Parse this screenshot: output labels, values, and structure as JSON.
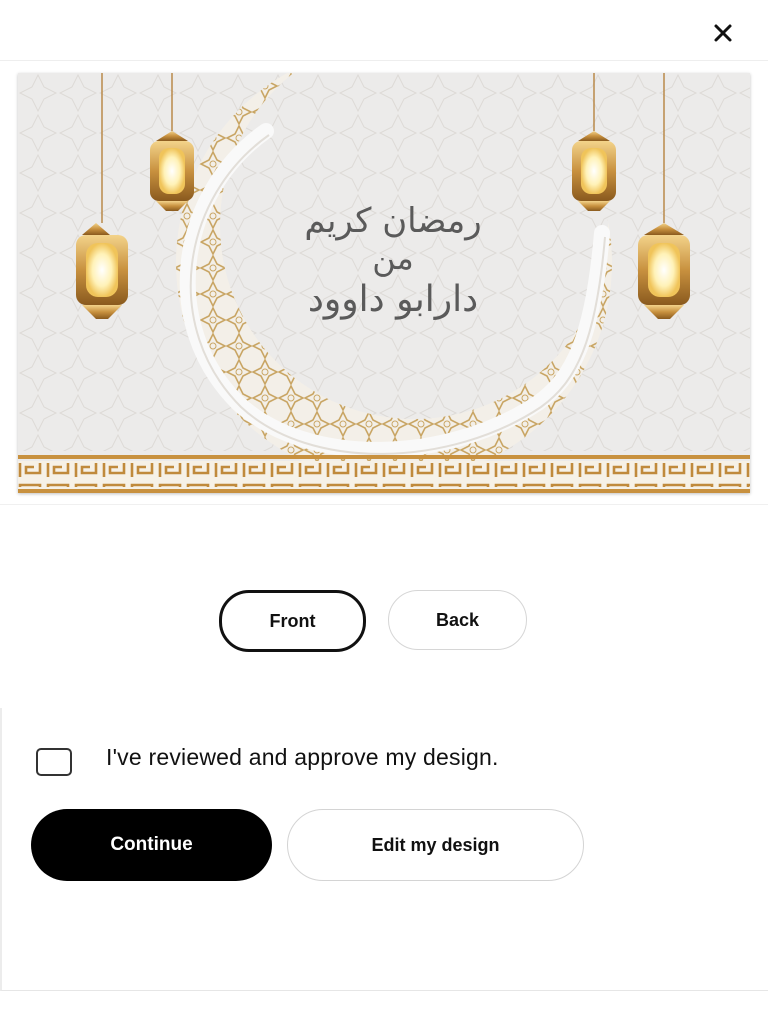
{
  "header": {
    "close_icon": "close-icon"
  },
  "preview": {
    "greeting_line1": "رمضان كريم",
    "greeting_line2": "من",
    "greeting_line3": "دارابو داوود",
    "colors": {
      "gold": "#c89a4a",
      "background": "#ecebea",
      "moon": "#f7f7f7"
    }
  },
  "sides": {
    "front_label": "Front",
    "back_label": "Back",
    "selected": "Front"
  },
  "approval": {
    "checkbox_checked": false,
    "label": "I've reviewed and approve my design.",
    "continue_label": "Continue",
    "edit_label": "Edit my design"
  }
}
